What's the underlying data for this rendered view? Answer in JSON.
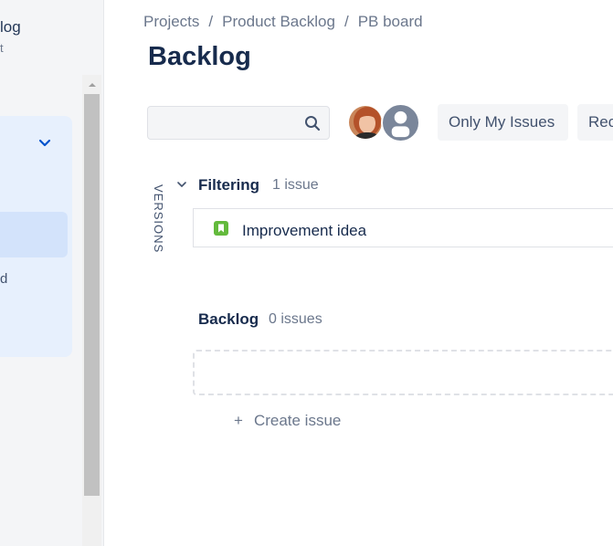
{
  "sidebar": {
    "title": "log",
    "subtitle": "t",
    "item_label": "d"
  },
  "breadcrumb": {
    "items": [
      "Projects",
      "Product Backlog",
      "PB board"
    ],
    "separator": "/"
  },
  "page_title": "Backlog",
  "search": {
    "value": "",
    "placeholder": ""
  },
  "filters": {
    "only_my_issues": "Only My Issues",
    "recently_updated": "Rec"
  },
  "versions_tab": "VERSIONS",
  "sprint": {
    "name": "Filtering",
    "count": "1 issue",
    "issues": [
      {
        "type": "story-icon",
        "summary": "Improvement idea"
      }
    ]
  },
  "backlog": {
    "name": "Backlog",
    "count": "0 issues",
    "create_label": "Create issue",
    "create_icon": "+"
  },
  "colors": {
    "accent": "#0052cc",
    "sidebar_panel": "#e7f0fd",
    "sidebar_active": "#d3e3fb",
    "story_green": "#63ba3c"
  }
}
